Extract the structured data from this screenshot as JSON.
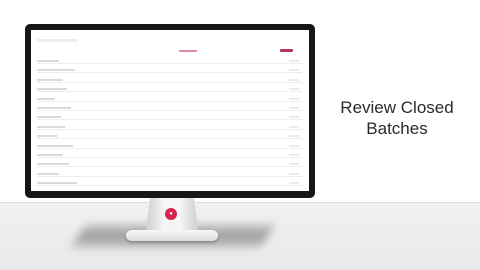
{
  "caption": {
    "line1": "Review Closed",
    "line2": "Batches"
  },
  "brand": {
    "logo_icon": "brand-logo-icon",
    "color": "#d72250"
  },
  "screen": {
    "accent_color": "#b8335f",
    "row_count": 14
  }
}
